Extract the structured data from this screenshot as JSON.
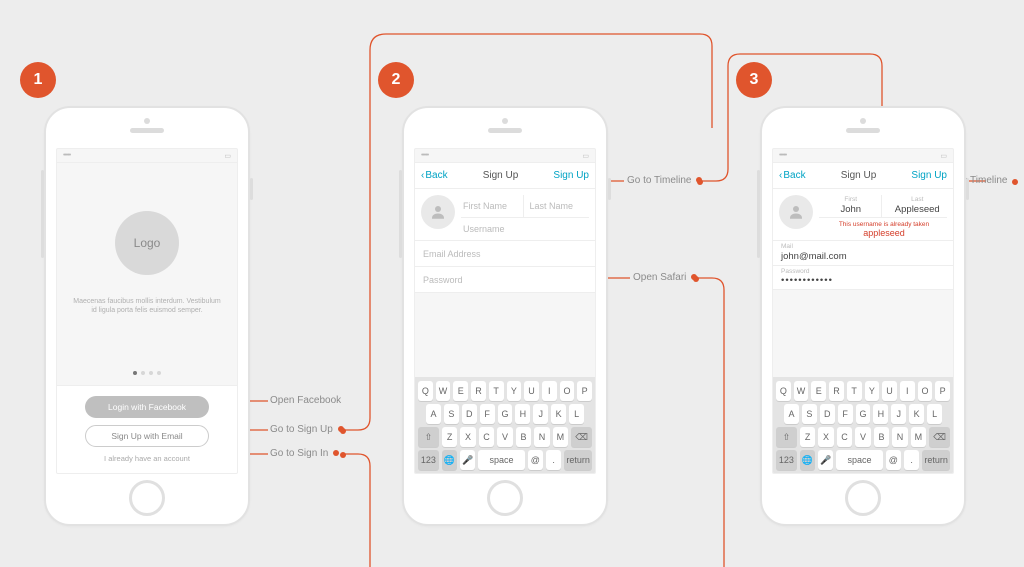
{
  "steps": {
    "s1": "1",
    "s2": "2",
    "s3": "3"
  },
  "phone1": {
    "logo_label": "Logo",
    "blurb": "Maecenas faucibus mollis interdum. Vestibulum id ligula porta felis euismod semper.",
    "login_fb": "Login with Facebook",
    "signup_email": "Sign Up with Email",
    "have_account": "I already have an account"
  },
  "phone2": {
    "nav_back": "Back",
    "nav_title": "Sign Up",
    "nav_action": "Sign Up",
    "ph_first": "First Name",
    "ph_last": "Last Name",
    "ph_username": "Username",
    "ph_email": "Email Address",
    "ph_password": "Password"
  },
  "phone3": {
    "nav_back": "Back",
    "nav_title": "Sign Up",
    "nav_action": "Sign Up",
    "label_first": "First",
    "value_first": "John",
    "label_last": "Last",
    "value_last": "Appleseed",
    "err_msg": "This username is already taken",
    "err_value": "appleseed",
    "label_mail": "Mail",
    "value_mail": "john@mail.com",
    "label_password": "Password",
    "value_password": "••••••••••••"
  },
  "keyboard": {
    "row1": [
      "Q",
      "W",
      "E",
      "R",
      "T",
      "Y",
      "U",
      "I",
      "O",
      "P"
    ],
    "row2": [
      "A",
      "S",
      "D",
      "F",
      "G",
      "H",
      "J",
      "K",
      "L"
    ],
    "row3": [
      "Z",
      "X",
      "C",
      "V",
      "B",
      "N",
      "M"
    ],
    "shift": "⇧",
    "del": "⌫",
    "num": "123",
    "globe": "🌐",
    "mic": "🎤",
    "space": "space",
    "at": "@",
    "dot": ".",
    "ret": "return"
  },
  "annotations": {
    "open_facebook": "Open Facebook",
    "go_to_signup": "Go to Sign Up",
    "go_to_signin": "Go to Sign In",
    "go_to_timeline_1": "Go to Timeline",
    "open_safari": "Open Safari",
    "go_to_timeline_2": "Go to Timeline"
  },
  "statusbar": {
    "signal": "•••••",
    "battery": "▭"
  }
}
